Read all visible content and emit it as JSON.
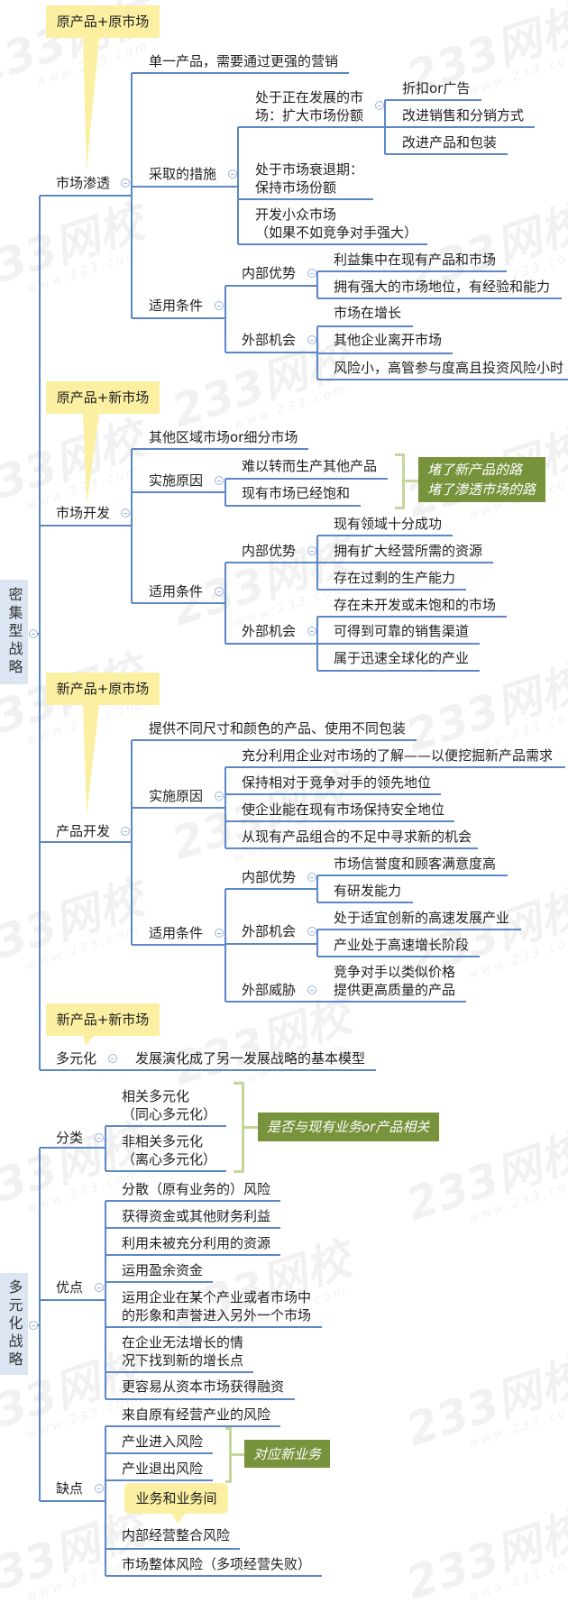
{
  "colors": {
    "line": "#5b87c6",
    "callout": "#fbf0a2",
    "note": "#77933c",
    "bracket": "#c4d79b",
    "root_bg": "#dce6f2"
  },
  "watermark": {
    "brand": "233网校",
    "url": "www.233.com"
  },
  "roots": [
    {
      "label": "密集型战略",
      "branches": [
        {
          "label": "市场渗透",
          "callout": "原产品+原市场",
          "children": [
            {
              "label": "单一产品，需要通过更强的营销"
            },
            {
              "label": "采取的措施",
              "children": [
                {
                  "label": "处于正在发展的市\n场：扩大市场份额",
                  "children": [
                    {
                      "label": "折扣or广告"
                    },
                    {
                      "label": "改进销售和分销方式"
                    },
                    {
                      "label": "改进产品和包装"
                    }
                  ]
                },
                {
                  "label": "处于市场衰退期：\n保持市场份额"
                },
                {
                  "label": "开发小众市场\n（如果不如竞争对手强大）"
                }
              ]
            },
            {
              "label": "适用条件",
              "children": [
                {
                  "label": "内部优势",
                  "children": [
                    {
                      "label": "利益集中在现有产品和市场"
                    },
                    {
                      "label": "拥有强大的市场地位，有经验和能力"
                    }
                  ]
                },
                {
                  "label": "外部机会",
                  "children": [
                    {
                      "label": "市场在增长"
                    },
                    {
                      "label": "其他企业离开市场"
                    },
                    {
                      "label": "风险小，高管参与度高且投资风险小时"
                    }
                  ]
                }
              ]
            }
          ]
        },
        {
          "label": "市场开发",
          "callout": "原产品+新市场",
          "children": [
            {
              "label": "其他区域市场or细分市场"
            },
            {
              "label": "实施原因",
              "note": "堵了新产品的路\n堵了渗透市场的路",
              "children": [
                {
                  "label": "难以转而生产其他产品"
                },
                {
                  "label": "现有市场已经饱和"
                }
              ]
            },
            {
              "label": "适用条件",
              "children": [
                {
                  "label": "内部优势",
                  "children": [
                    {
                      "label": "现有领域十分成功"
                    },
                    {
                      "label": "拥有扩大经营所需的资源"
                    },
                    {
                      "label": "存在过剩的生产能力"
                    }
                  ]
                },
                {
                  "label": "外部机会",
                  "children": [
                    {
                      "label": "存在未开发或未饱和的市场"
                    },
                    {
                      "label": "可得到可靠的销售渠道"
                    },
                    {
                      "label": "属于迅速全球化的产业"
                    }
                  ]
                }
              ]
            }
          ]
        },
        {
          "label": "产品开发",
          "callout": "新产品+原市场",
          "children": [
            {
              "label": "提供不同尺寸和颜色的产品、使用不同包装"
            },
            {
              "label": "实施原因",
              "children": [
                {
                  "label": "充分利用企业对市场的了解——以便挖掘新产品需求"
                },
                {
                  "label": "保持相对于竞争对手的领先地位"
                },
                {
                  "label": "使企业能在现有市场保持安全地位"
                },
                {
                  "label": "从现有产品组合的不足中寻求新的机会"
                }
              ]
            },
            {
              "label": "适用条件",
              "children": [
                {
                  "label": "内部优势",
                  "children": [
                    {
                      "label": "市场信誉度和顾客满意度高"
                    },
                    {
                      "label": "有研发能力"
                    }
                  ]
                },
                {
                  "label": "外部机会",
                  "children": [
                    {
                      "label": "处于适宜创新的高速发展产业"
                    },
                    {
                      "label": "产业处于高速增长阶段"
                    }
                  ]
                },
                {
                  "label": "外部威胁",
                  "children": [
                    {
                      "label": "竞争对手以类似价格\n提供更高质量的产品"
                    }
                  ]
                }
              ]
            }
          ]
        },
        {
          "label": "多元化",
          "callout": "新产品+新市场",
          "children": [
            {
              "label": "发展演化成了另一发展战略的基本模型"
            }
          ]
        }
      ]
    },
    {
      "label": "多元化战略",
      "branches": [
        {
          "label": "分类",
          "note": "是否与现有业务or产品相关",
          "children": [
            {
              "label": "相关多元化\n（同心多元化）"
            },
            {
              "label": "非相关多元化\n（离心多元化）"
            }
          ]
        },
        {
          "label": "优点",
          "children": [
            {
              "label": "分散（原有业务的）风险"
            },
            {
              "label": "获得资金或其他财务利益"
            },
            {
              "label": "利用未被充分利用的资源"
            },
            {
              "label": "运用盈余资金"
            },
            {
              "label": "运用企业在某个产业或者市场中\n的形象和声誉进入另外一个市场"
            },
            {
              "label": "在企业无法增长的情\n况下找到新的增长点"
            },
            {
              "label": "更容易从资本市场获得融资"
            }
          ]
        },
        {
          "label": "缺点",
          "note": "对应新业务",
          "callout": "业务和业务间",
          "children": [
            {
              "label": "来自原有经营产业的风险"
            },
            {
              "label": "产业进入风险"
            },
            {
              "label": "产业退出风险"
            },
            {
              "label": "内部经营整合风险"
            },
            {
              "label": "市场整体风险（多项经营失败）"
            }
          ]
        }
      ]
    }
  ]
}
